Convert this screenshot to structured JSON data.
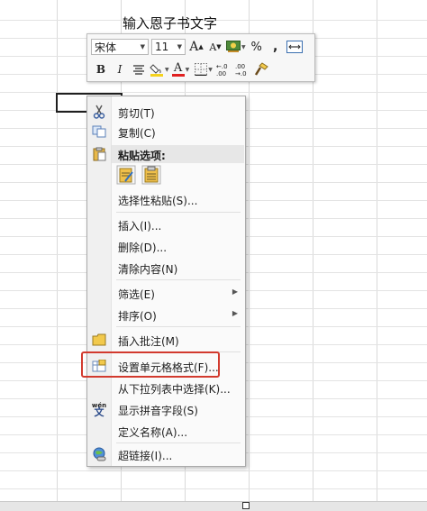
{
  "cell": {
    "text": "输入恩子书文字"
  },
  "mini_toolbar": {
    "font_name": "宋体",
    "font_size": "11",
    "grow_font": "A",
    "shrink_font": "A",
    "percent": "%",
    "comma": ",",
    "bold": "B",
    "italic": "I",
    "font_color_letter": "A",
    "increase_decimal": "+.0 .00",
    "decrease_decimal": ".00 +.0"
  },
  "context_menu": {
    "items": [
      {
        "label": "剪切(T)",
        "icon": "scissors-icon"
      },
      {
        "label": "复制(C)",
        "icon": "copy-icon"
      },
      {
        "label": "粘贴选项:",
        "icon": "clipboard-icon"
      },
      {
        "label": "选择性粘贴(S)..."
      },
      {
        "label": "插入(I)..."
      },
      {
        "label": "删除(D)..."
      },
      {
        "label": "清除内容(N)"
      },
      {
        "label": "筛选(E)"
      },
      {
        "label": "排序(O)"
      },
      {
        "label": "插入批注(M)",
        "icon": "comment-icon"
      },
      {
        "label": "设置单元格格式(F)...",
        "icon": "format-cells-icon"
      },
      {
        "label": "从下拉列表中选择(K)..."
      },
      {
        "label": "显示拼音字段(S)",
        "icon": "phonetic-icon"
      },
      {
        "label": "定义名称(A)..."
      },
      {
        "label": "超链接(I)...",
        "icon": "hyperlink-icon"
      }
    ],
    "phonetic_icon_text": "wén",
    "phonetic_icon_char": "文"
  },
  "colors": {
    "highlight_border": "#d23a2e",
    "fill_color": "#f5d21c",
    "font_color": "#e02020",
    "grid_line": "#d4d4d4"
  }
}
